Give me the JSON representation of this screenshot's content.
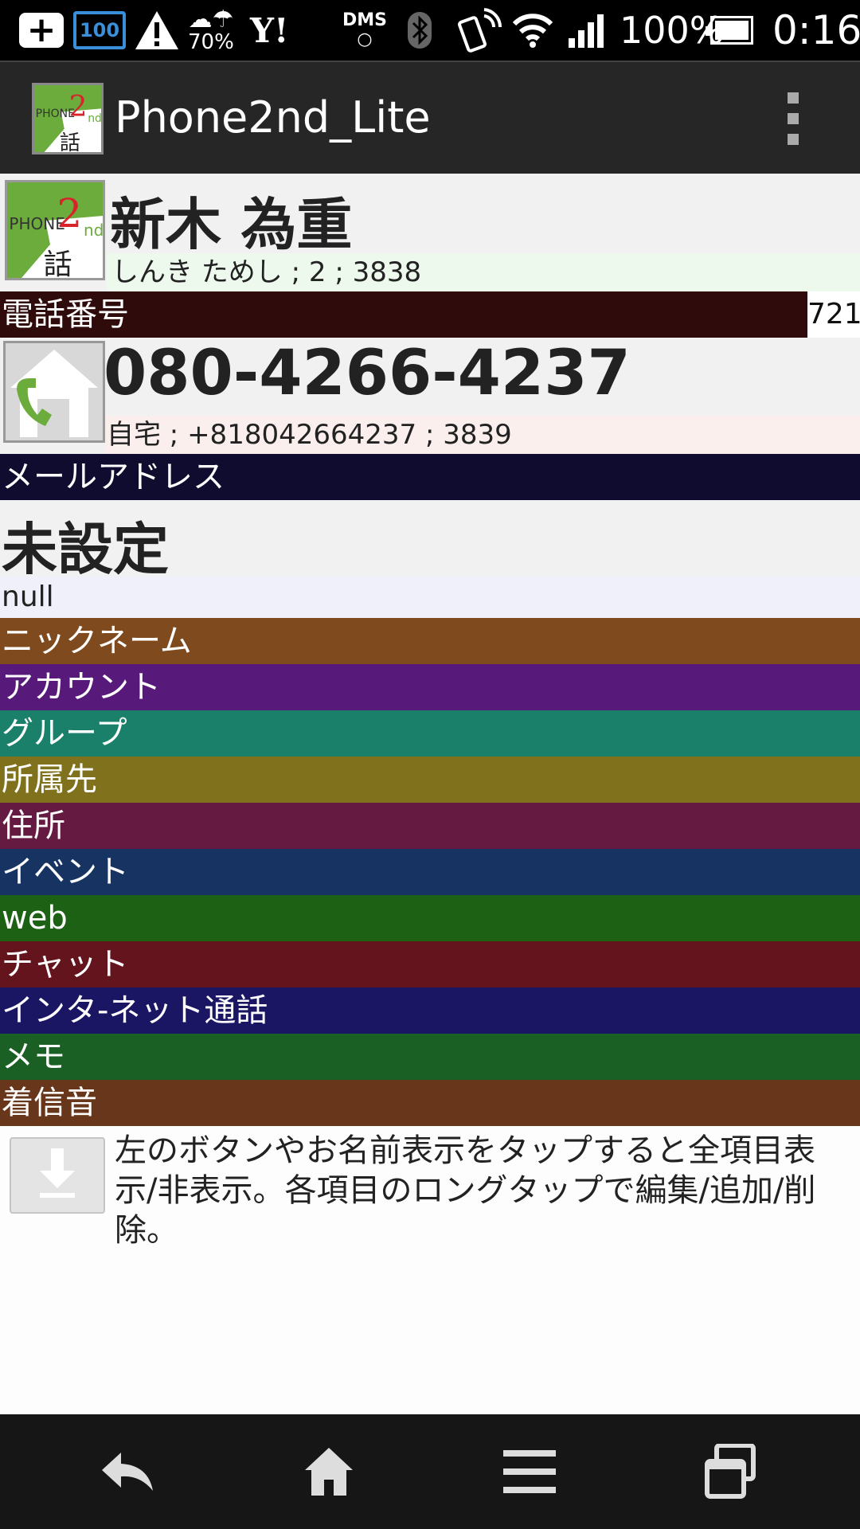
{
  "status_bar": {
    "plus_icon": "plus-box-icon",
    "battery_100_label": "100",
    "weather_percent": "70%",
    "yahoo_label": "Y!",
    "dms_label": "DMS",
    "dms_circle": "○",
    "battery_percent": "100%",
    "time": "0:16"
  },
  "action_bar": {
    "title": "Phone2nd_Lite",
    "logo_text": "PHONE",
    "logo_two": "2",
    "logo_nd": "nd",
    "logo_kanji": "話"
  },
  "contact": {
    "name": "新木 為重",
    "reading": "しんき ためし ; 2 ; 3838"
  },
  "phone_section": {
    "header": "電話番号",
    "count": "721",
    "number": "080-4266-4237",
    "sub": "自宅 ; +818042664237 ; 3839"
  },
  "mail_section": {
    "header": "メールアドレス",
    "value": "未設定",
    "sub": "null"
  },
  "sections": [
    {
      "label": "ニックネーム",
      "color": "#7f4a1d"
    },
    {
      "label": "アカウント",
      "color": "#571a7a"
    },
    {
      "label": "グループ",
      "color": "#1b806a"
    },
    {
      "label": "所属先",
      "color": "#80721c"
    },
    {
      "label": "住所",
      "color": "#651a41"
    },
    {
      "label": "イベント",
      "color": "#163361"
    },
    {
      "label": "web",
      "color": "#1d6114"
    },
    {
      "label": "チャット",
      "color": "#63141c"
    },
    {
      "label": "インタ-ネット通話",
      "color": "#1b1664"
    },
    {
      "label": "メモ",
      "color": "#1a6024"
    },
    {
      "label": "着信音",
      "color": "#68361a"
    }
  ],
  "hint": {
    "text": "左のボタンやお名前表示をタップすると全項目表示/非表示。各項目のロングタップで編集/追加/削除。"
  },
  "nav_bar": {
    "back_icon": "back-icon",
    "home_icon": "home-icon",
    "menu_icon": "menu-icon",
    "recents_icon": "recent-apps-icon"
  }
}
